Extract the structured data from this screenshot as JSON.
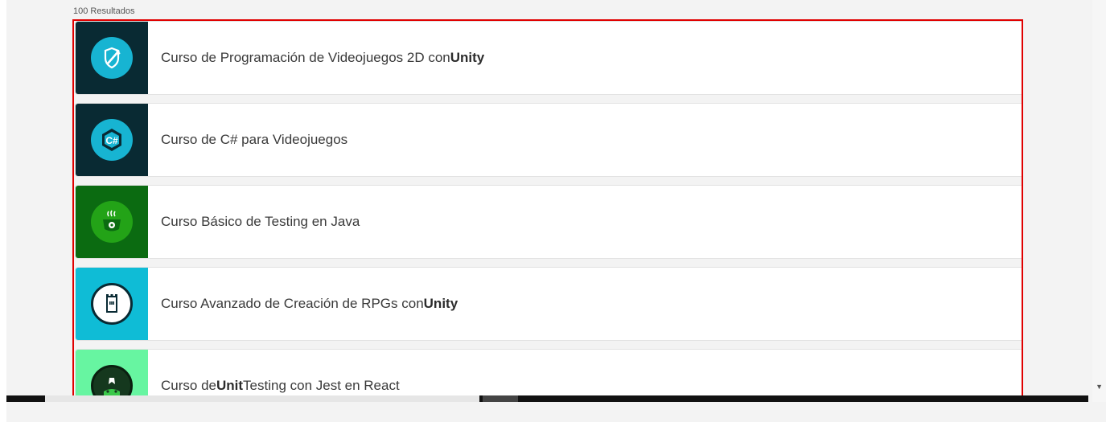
{
  "results": {
    "count_label": "100 Resultados"
  },
  "courses": [
    {
      "pre": "Curso de Programación de Videojuegos 2D con ",
      "bold": "Unity",
      "post": "",
      "icon": "shield-sword-icon",
      "badge_color": "#092a33",
      "circle_color": "#17b4d2"
    },
    {
      "pre": "Curso de C# para Videojuegos",
      "bold": "",
      "post": "",
      "icon": "csharp-hexagon-icon",
      "badge_color": "#092a33",
      "circle_color": "#17b4d2"
    },
    {
      "pre": "Curso Básico de Testing en Java",
      "bold": "",
      "post": "",
      "icon": "coffee-cup-gear-icon",
      "badge_color": "#0b6b11",
      "circle_color": "#23a317"
    },
    {
      "pre": "Curso Avanzado de Creación de RPGs con ",
      "bold": "Unity",
      "post": "",
      "icon": "castle-tower-icon",
      "badge_color": "#0fbcd6",
      "circle_color": "#ffffff"
    },
    {
      "pre": "Curso de ",
      "bold": "Unit",
      "post": " Testing con Jest en React",
      "icon": "jest-crown-icon",
      "badge_color": "#67f5a1",
      "circle_color": "#15381e"
    }
  ],
  "colors": {
    "frame_highlight": "#e00000"
  }
}
